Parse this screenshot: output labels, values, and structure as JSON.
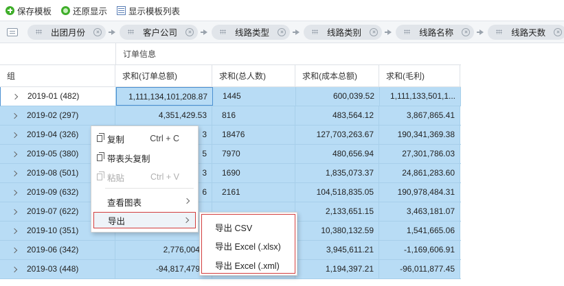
{
  "toolbar": {
    "save_template": "保存模板",
    "restore_display": "还原显示",
    "show_template_list": "显示模板列表"
  },
  "pivot": {
    "chips": [
      "出团月份",
      "客户公司",
      "线路类型",
      "线路类别",
      "线路名称",
      "线路天数"
    ]
  },
  "grid": {
    "group_header": "订单信息",
    "columns": [
      "组",
      "求和(订单总额)",
      "求和(总人数)",
      "求和(成本总额)",
      "求和(毛利)"
    ],
    "rows": [
      [
        "2019-01 (482)",
        "1,111,134,101,208.87",
        "1445",
        "600,039.52",
        "1,111,133,501,1..."
      ],
      [
        "2019-02 (297)",
        "4,351,429.53",
        "816",
        "483,564.12",
        "3,867,865.41"
      ],
      [
        "2019-04 (326)",
        "3",
        "18476",
        "127,703,263.67",
        "190,341,369.38"
      ],
      [
        "2019-05 (380)",
        "5",
        "7970",
        "480,656.94",
        "27,301,786.03"
      ],
      [
        "2019-08 (501)",
        "3",
        "1690",
        "1,835,073.37",
        "24,861,283.60"
      ],
      [
        "2019-09 (632)",
        "6",
        "2161",
        "104,518,835.05",
        "190,978,484.31"
      ],
      [
        "2019-07 (622)",
        "",
        "",
        "2,133,651.15",
        "3,463,181.07"
      ],
      [
        "2019-10 (351)",
        "",
        "",
        "10,380,132.59",
        "1,541,665.06"
      ],
      [
        "2019-06 (342)",
        "2,776,004.2",
        "",
        "3,945,611.21",
        "-1,169,606.91"
      ],
      [
        "2019-03 (448)",
        "-94,817,479.9",
        "",
        "1,194,397.21",
        "-96,011,877.45"
      ]
    ]
  },
  "context_menu": {
    "copy": "复制",
    "copy_shortcut": "Ctrl + C",
    "copy_with_header": "带表头复制",
    "paste": "粘贴",
    "paste_shortcut": "Ctrl + V",
    "view_chart": "查看图表",
    "export": "导出"
  },
  "export_menu": {
    "csv": "导出 CSV",
    "xlsx": "导出 Excel (.xlsx)",
    "xml": "导出 Excel (.xml)"
  },
  "colors": {
    "row_selected": "#b8dcf5",
    "highlight_border": "#d23b3b",
    "icon_green": "#3fae2a"
  }
}
